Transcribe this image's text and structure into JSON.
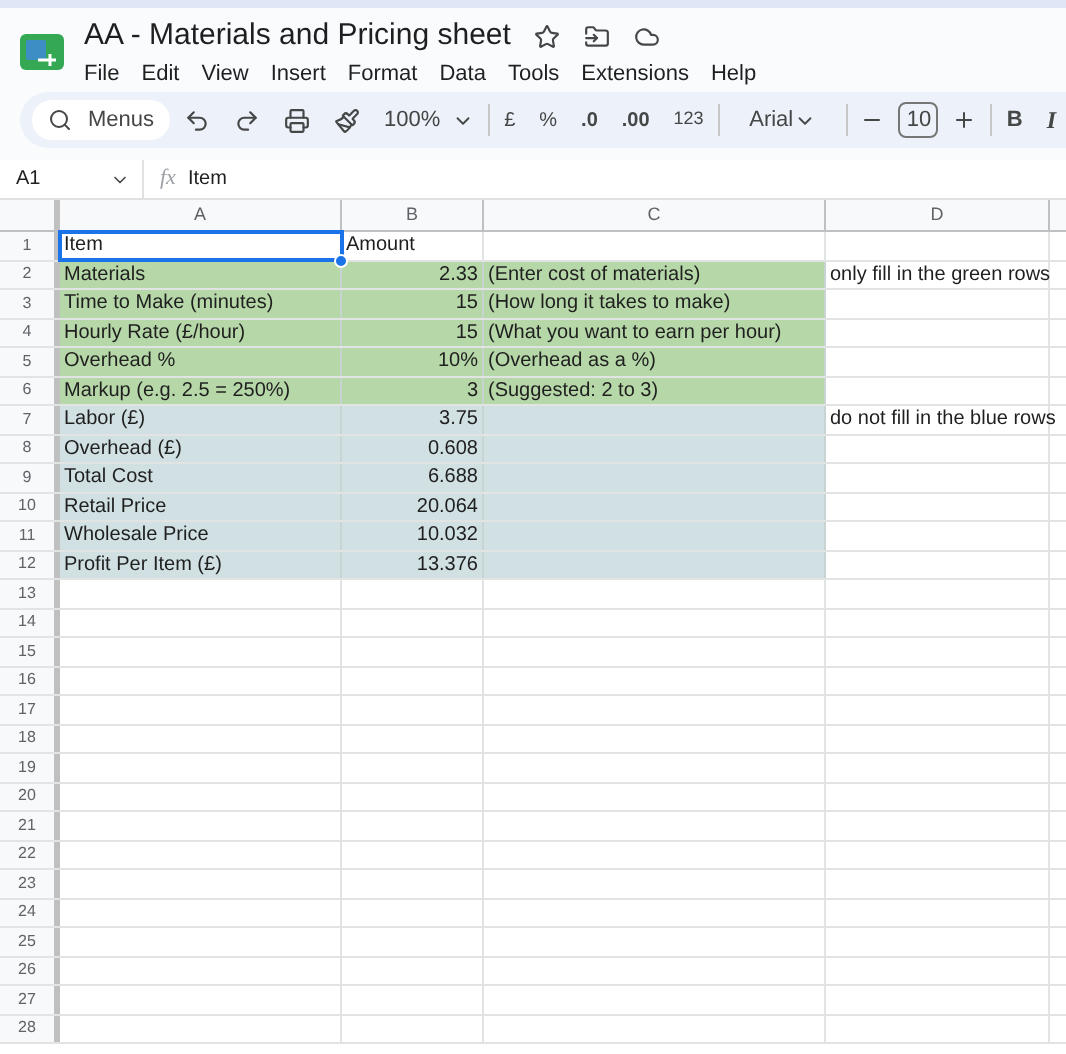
{
  "document": {
    "title": "AA - Materials and Pricing sheet"
  },
  "menu": [
    "File",
    "Edit",
    "View",
    "Insert",
    "Format",
    "Data",
    "Tools",
    "Extensions",
    "Help"
  ],
  "toolbar": {
    "search": "Menus",
    "zoom": "100%",
    "currency": "£",
    "percent": "%",
    "decrease_decimals": ".0",
    "increase_decimals": ".00",
    "number_format": "123",
    "font": "Arial",
    "font_size": "10",
    "bold": "B",
    "italic": "I"
  },
  "formula_bar": {
    "cell_ref": "A1",
    "function_label": "fx",
    "formula": "Item"
  },
  "columns": [
    "A",
    "B",
    "C",
    "D"
  ],
  "rows": [
    {
      "number": "1",
      "cells": [
        {
          "text": "Item",
          "selected": true
        },
        {
          "text": "Amount",
          "selected": false
        },
        {
          "selected": false
        },
        {
          "selected": false
        }
      ]
    },
    {
      "number": "2",
      "color": "#b6d7a8",
      "cells": [
        {
          "text": "Materials",
          "selected": false
        },
        {
          "text": "2.33",
          "kind": "number",
          "selected": false
        },
        {
          "text": "(Enter cost of materials)",
          "selected": false
        },
        {
          "text": "only fill in the green rows",
          "selected": false
        }
      ]
    },
    {
      "number": "3",
      "color": "#b6d7a8",
      "cells": [
        {
          "text": "Time to Make (minutes)",
          "selected": false
        },
        {
          "text": "15",
          "kind": "number",
          "selected": false
        },
        {
          "text": "(How long it takes to make)",
          "selected": false
        },
        {
          "selected": false
        }
      ]
    },
    {
      "number": "4",
      "color": "#b6d7a8",
      "cells": [
        {
          "text": "Hourly Rate (£/hour)",
          "selected": false
        },
        {
          "text": "15",
          "kind": "number",
          "selected": false
        },
        {
          "text": "(What you want to earn per hour)",
          "selected": false
        },
        {
          "selected": false
        }
      ]
    },
    {
      "number": "5",
      "color": "#b6d7a8",
      "cells": [
        {
          "text": "Overhead %",
          "selected": false
        },
        {
          "text": "10%",
          "kind": "number",
          "selected": false
        },
        {
          "text": "(Overhead as a %)",
          "selected": false
        },
        {
          "selected": false
        }
      ]
    },
    {
      "number": "6",
      "color": "#b6d7a8",
      "cells": [
        {
          "text": "Markup (e.g. 2.5 = 250%)",
          "selected": false
        },
        {
          "text": "3",
          "kind": "number",
          "selected": false
        },
        {
          "text": "(Suggested: 2 to 3)",
          "selected": false
        },
        {
          "selected": false
        }
      ]
    },
    {
      "number": "7",
      "color": "#d0e0e3",
      "cells": [
        {
          "text": "Labor (£)",
          "selected": false
        },
        {
          "text": "3.75",
          "kind": "number",
          "selected": false
        },
        {
          "selected": false
        },
        {
          "text": "do not fill in the blue rows",
          "selected": false
        }
      ]
    },
    {
      "number": "8",
      "color": "#d0e0e3",
      "cells": [
        {
          "text": "Overhead (£)",
          "selected": false
        },
        {
          "text": "0.608",
          "kind": "number",
          "selected": false
        },
        {
          "selected": false
        },
        {
          "selected": false
        }
      ]
    },
    {
      "number": "9",
      "color": "#d0e0e3",
      "cells": [
        {
          "text": "Total Cost",
          "selected": false
        },
        {
          "text": "6.688",
          "kind": "number",
          "selected": false
        },
        {
          "selected": false
        },
        {
          "selected": false
        }
      ]
    },
    {
      "number": "10",
      "color": "#d0e0e3",
      "cells": [
        {
          "text": "Retail Price",
          "selected": false
        },
        {
          "text": "20.064",
          "kind": "number",
          "selected": false
        },
        {
          "selected": false
        },
        {
          "selected": false
        }
      ]
    },
    {
      "number": "11",
      "color": "#d0e0e3",
      "cells": [
        {
          "text": "Wholesale Price",
          "selected": false
        },
        {
          "text": "10.032",
          "kind": "number",
          "selected": false
        },
        {
          "selected": false
        },
        {
          "selected": false
        }
      ]
    },
    {
      "number": "12",
      "color": "#d0e0e3",
      "cells": [
        {
          "text": "Profit Per Item (£)",
          "selected": false
        },
        {
          "text": "13.376",
          "kind": "number",
          "selected": false
        },
        {
          "selected": false
        },
        {
          "selected": false
        }
      ]
    },
    {
      "number": "13"
    },
    {
      "number": "14"
    },
    {
      "number": "15"
    },
    {
      "number": "16"
    },
    {
      "number": "17"
    },
    {
      "number": "18"
    },
    {
      "number": "19"
    },
    {
      "number": "20"
    },
    {
      "number": "21"
    },
    {
      "number": "22"
    },
    {
      "number": "23"
    },
    {
      "number": "24"
    },
    {
      "number": "25"
    },
    {
      "number": "26"
    },
    {
      "number": "27"
    },
    {
      "number": "28"
    }
  ]
}
